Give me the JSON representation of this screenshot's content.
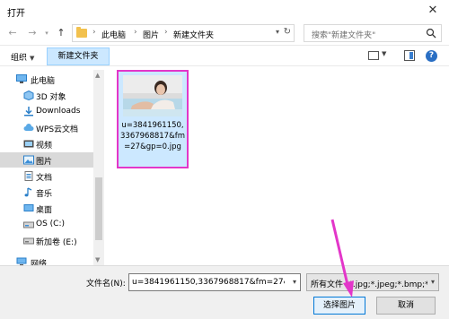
{
  "window": {
    "title": "打开"
  },
  "address": {
    "crumbs": [
      "此电脑",
      "图片",
      "新建文件夹"
    ]
  },
  "search": {
    "placeholder": "搜索\"新建文件夹\""
  },
  "toolbar": {
    "organize": "组织",
    "new_folder": "新建文件夹"
  },
  "nav": {
    "items": [
      {
        "label": "此电脑",
        "icon": "computer-icon",
        "selected": false
      },
      {
        "label": "3D 对象",
        "icon": "cube-3d-icon",
        "selected": false
      },
      {
        "label": "Downloads",
        "icon": "download-icon",
        "selected": false
      },
      {
        "label": "WPS云文档",
        "icon": "cloud-icon",
        "selected": false
      },
      {
        "label": "视频",
        "icon": "video-icon",
        "selected": false
      },
      {
        "label": "图片",
        "icon": "picture-icon",
        "selected": true
      },
      {
        "label": "文档",
        "icon": "document-icon",
        "selected": false
      },
      {
        "label": "音乐",
        "icon": "music-icon",
        "selected": false
      },
      {
        "label": "桌面",
        "icon": "desktop-icon",
        "selected": false
      },
      {
        "label": "OS (C:)",
        "icon": "drive-icon",
        "selected": false
      },
      {
        "label": "新加卷 (E:)",
        "icon": "drive-icon",
        "selected": false
      },
      {
        "label": "网络",
        "icon": "network-icon",
        "selected": false
      }
    ]
  },
  "file": {
    "name": "u=3841961150,3367968817&fm=27&gp=0.jpg"
  },
  "bottom": {
    "filename_label": "文件名(N):",
    "filename_value": "u=3841961150,3367968817&fm=27&gp",
    "filter_value": "所有文件 (*.jpg;*.jpeg;*.bmp;*.",
    "open_label": "选择图片",
    "cancel_label": "取消"
  },
  "colors": {
    "highlight": "#e336c9",
    "selection": "#cce8ff",
    "accent": "#0078d7"
  }
}
